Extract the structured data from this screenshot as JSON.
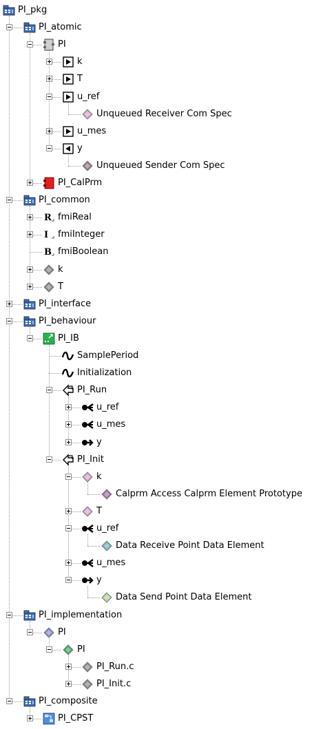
{
  "tree": [
    {
      "label": "PI_pkg",
      "icon": "package-icon",
      "depth": 0,
      "state": "none"
    },
    {
      "label": "PI_atomic",
      "icon": "package-icon",
      "depth": 1,
      "state": "expanded"
    },
    {
      "label": "PI",
      "icon": "component-icon",
      "depth": 2,
      "state": "expanded"
    },
    {
      "label": "k",
      "icon": "in-port-icon",
      "depth": 3,
      "state": "collapsed"
    },
    {
      "label": "T",
      "icon": "in-port-icon",
      "depth": 3,
      "state": "collapsed"
    },
    {
      "label": "u_ref",
      "icon": "in-port-icon",
      "depth": 3,
      "state": "expanded"
    },
    {
      "label": "Unqueued Receiver Com Spec",
      "icon": "diamond-pink-icon",
      "depth": 4,
      "state": "none"
    },
    {
      "label": "u_mes",
      "icon": "in-port-icon",
      "depth": 3,
      "state": "collapsed"
    },
    {
      "label": "y",
      "icon": "out-port-icon",
      "depth": 3,
      "state": "expanded"
    },
    {
      "label": "Unqueued Sender Com Spec",
      "icon": "diamond-brown-icon",
      "depth": 4,
      "state": "none"
    },
    {
      "label": "PI_CalPrm",
      "icon": "calprm-component-icon",
      "depth": 2,
      "state": "collapsed"
    },
    {
      "label": "PI_common",
      "icon": "package-icon",
      "depth": 1,
      "state": "expanded"
    },
    {
      "label": "fmiReal",
      "icon": "real-type-icon",
      "depth": 2,
      "state": "collapsed"
    },
    {
      "label": "fmiInteger",
      "icon": "integer-type-icon",
      "depth": 2,
      "state": "collapsed"
    },
    {
      "label": "fmiBoolean",
      "icon": "boolean-type-icon",
      "depth": 2,
      "state": "none"
    },
    {
      "label": "k",
      "icon": "diamond-gray-icon",
      "depth": 2,
      "state": "collapsed"
    },
    {
      "label": "T",
      "icon": "diamond-gray-icon",
      "depth": 2,
      "state": "collapsed"
    },
    {
      "label": "PI_interface",
      "icon": "package-icon",
      "depth": 1,
      "state": "collapsed"
    },
    {
      "label": "PI_behaviour",
      "icon": "package-icon",
      "depth": 1,
      "state": "expanded"
    },
    {
      "label": "PI_IB",
      "icon": "internal-behavior-icon",
      "depth": 2,
      "state": "expanded"
    },
    {
      "label": "SamplePeriod",
      "icon": "timing-event-icon",
      "depth": 3,
      "state": "none"
    },
    {
      "label": "Initialization",
      "icon": "timing-event-icon",
      "depth": 3,
      "state": "none"
    },
    {
      "label": "PI_Run",
      "icon": "runnable-icon",
      "depth": 3,
      "state": "expanded"
    },
    {
      "label": "u_ref",
      "icon": "read-access-icon",
      "depth": 4,
      "state": "collapsed"
    },
    {
      "label": "u_mes",
      "icon": "read-access-icon",
      "depth": 4,
      "state": "collapsed"
    },
    {
      "label": "y",
      "icon": "write-access-icon",
      "depth": 4,
      "state": "collapsed"
    },
    {
      "label": "PI_Init",
      "icon": "runnable-icon",
      "depth": 3,
      "state": "expanded"
    },
    {
      "label": "k",
      "icon": "diamond-pink-icon",
      "depth": 4,
      "state": "expanded"
    },
    {
      "label": "Calprm Access Calprm Element Prototype",
      "icon": "diamond-purple-icon",
      "depth": 5,
      "state": "none"
    },
    {
      "label": "T",
      "icon": "diamond-pink-icon",
      "depth": 4,
      "state": "collapsed"
    },
    {
      "label": "u_ref",
      "icon": "read-access-icon",
      "depth": 4,
      "state": "expanded"
    },
    {
      "label": "Data Receive Point Data Element",
      "icon": "diamond-teal-icon",
      "depth": 5,
      "state": "none"
    },
    {
      "label": "u_mes",
      "icon": "read-access-icon",
      "depth": 4,
      "state": "collapsed"
    },
    {
      "label": "y",
      "icon": "write-access-icon",
      "depth": 4,
      "state": "expanded"
    },
    {
      "label": "Data Send Point Data Element",
      "icon": "diamond-lightgreen-icon",
      "depth": 5,
      "state": "none"
    },
    {
      "label": "PI_implementation",
      "icon": "package-icon",
      "depth": 1,
      "state": "expanded"
    },
    {
      "label": "PI",
      "icon": "diamond-blue-icon",
      "depth": 2,
      "state": "expanded"
    },
    {
      "label": "PI",
      "icon": "diamond-green-icon",
      "depth": 3,
      "state": "expanded"
    },
    {
      "label": "PI_Run.c",
      "icon": "diamond-gray-icon",
      "depth": 4,
      "state": "collapsed"
    },
    {
      "label": "PI_Init.c",
      "icon": "diamond-gray-icon",
      "depth": 4,
      "state": "collapsed"
    },
    {
      "label": "PI_composite",
      "icon": "package-icon",
      "depth": 1,
      "state": "expanded"
    },
    {
      "label": "PI_CPST",
      "icon": "composition-icon",
      "depth": 2,
      "state": "collapsed"
    }
  ],
  "colors": {
    "diamond-pink-icon": "#d4a8cc",
    "diamond-brown-icon": "#9c7d86",
    "diamond-purple-icon": "#a675a8",
    "diamond-teal-icon": "#7bb4bc",
    "diamond-lightgreen-icon": "#b6d2a4",
    "diamond-blue-icon": "#8a8fd0",
    "diamond-green-icon": "#4faa63",
    "diamond-gray-icon": "#8c8c8c",
    "calprm-red": "#e02020",
    "package-blue": "#3d6fb6",
    "internal-behavior-green": "#2eb04f"
  }
}
